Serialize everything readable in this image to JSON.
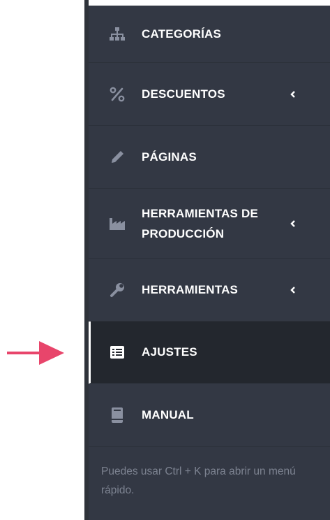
{
  "sidebar": {
    "items": [
      {
        "label": "CATEGORÍAS",
        "icon": "sitemap-icon",
        "has_submenu": false,
        "active": false
      },
      {
        "label": "DESCUENTOS",
        "icon": "percent-icon",
        "has_submenu": true,
        "active": false
      },
      {
        "label": "PÁGINAS",
        "icon": "pencil-icon",
        "has_submenu": false,
        "active": false
      },
      {
        "label": "HERRAMIENTAS DE PRODUCCIÓN",
        "icon": "factory-icon",
        "has_submenu": true,
        "active": false
      },
      {
        "label": "HERRAMIENTAS",
        "icon": "wrench-icon",
        "has_submenu": true,
        "active": false
      },
      {
        "label": "AJUSTES",
        "icon": "list-icon",
        "has_submenu": false,
        "active": true
      },
      {
        "label": "MANUAL",
        "icon": "book-icon",
        "has_submenu": false,
        "active": false
      }
    ],
    "hint": "Puedes usar Ctrl + K para abrir un menú rápido."
  },
  "colors": {
    "sidebar_bg": "#333844",
    "active_bg": "#23272e",
    "icon": "#8a90a0",
    "hint_text": "#7d8391",
    "arrow": "#e8456b"
  },
  "annotation": {
    "icon": "arrow-right-icon"
  }
}
